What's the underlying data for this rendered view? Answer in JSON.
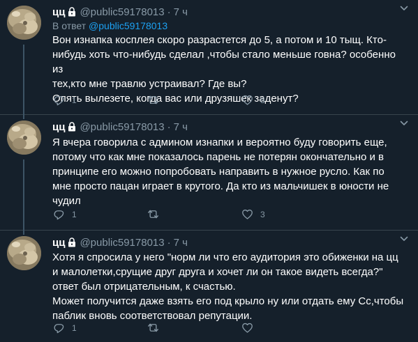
{
  "colors": {
    "background": "#15202b",
    "text": "#ffffff",
    "muted": "#8899a6",
    "link": "#1da1f2",
    "divider": "#38444d"
  },
  "tweets": [
    {
      "name": "цц",
      "handle": "@public59178013",
      "dot": "·",
      "time": "7 ч",
      "reply_label": "В ответ",
      "reply_to": "@public59178013",
      "lines": [
        "Вон изнапка косплея скоро разрастется до 5, а потом и 10 тыщ. Кто-",
        "нибудь хоть что-нибудь сделал ,чтобы стало меньше говна? особенно из",
        "тех,кто мне травлю устраивал? Где вы?",
        "Опять вылезете, когда вас или друзяшек заденут?"
      ],
      "replies": "1",
      "retweets": "",
      "likes": "8"
    },
    {
      "name": "цц",
      "handle": "@public59178013",
      "dot": "·",
      "time": "7 ч",
      "lines": [
        "Я вчера говорила с админом изнапки и вероятно буду говорить еще,",
        "потому что как мне показалось парень не потерян окончательно и в",
        "принципе его можно попробовать направить в нужное русло. Как по",
        "мне просто пацан играет в крутого.  Да кто из мальчишек в юности не",
        "чудил"
      ],
      "replies": "1",
      "retweets": "",
      "likes": "3"
    },
    {
      "name": "цц",
      "handle": "@public59178013",
      "dot": "·",
      "time": "7 ч",
      "lines": [
        "Хотя я спросила у него \"норм ли что его аудитория это обиженки на цц",
        "и малолетки,срущие друг друга и хочет ли он такое видеть всегда?\"",
        "ответ был отрицательным, к счастью.",
        "Может получится даже взять его под крыло ну или отдать ему Сс,чтобы",
        "паблик вновь соответствовал репутации."
      ],
      "replies": "1",
      "retweets": "",
      "likes": ""
    }
  ],
  "icons": {
    "lock": "lock-icon",
    "caret": "chevron-down-icon",
    "reply": "reply-icon",
    "retweet": "retweet-icon",
    "like": "heart-icon"
  }
}
